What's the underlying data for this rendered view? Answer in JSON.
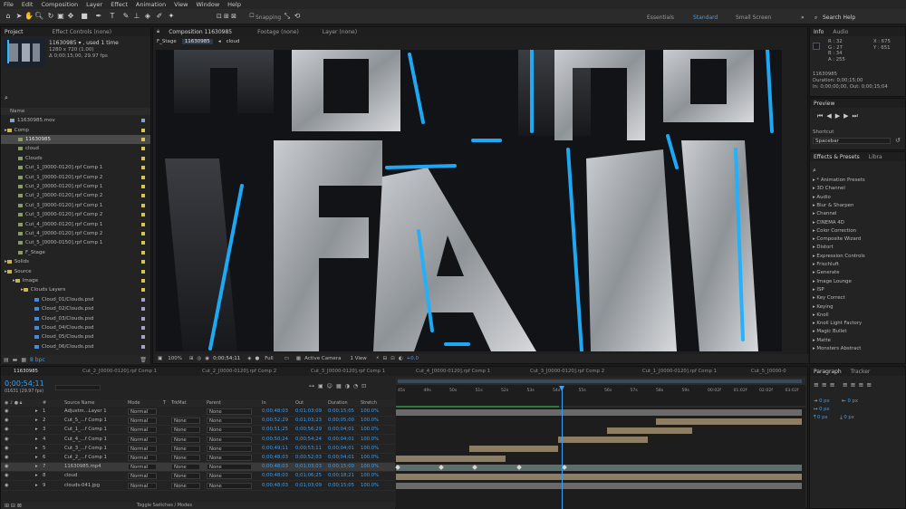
{
  "menu": [
    "File",
    "Edit",
    "Composition",
    "Layer",
    "Effect",
    "Animation",
    "View",
    "Window",
    "Help"
  ],
  "toolbar": {
    "snapping": "Snapping",
    "workspaces": [
      "Essentials",
      "Standard",
      "Small Screen"
    ],
    "search_placeholder": "Search Help"
  },
  "project": {
    "tabs": [
      "Project",
      "Effect Controls (none)"
    ],
    "item_name": "11630985 ▾ , used 1 time",
    "item_res": "1280 x 720 (1.00)",
    "item_dur": "Δ 0;00;15;00, 29.97 fps",
    "name_header": "Name",
    "bpc": "8 bpc",
    "tree": [
      {
        "label": "11630985.mov",
        "indent": 0,
        "kind": "file",
        "color": "#7fa6c8"
      },
      {
        "label": "Comp",
        "indent": 0,
        "kind": "folder",
        "color": "#d9c54a"
      },
      {
        "label": "11630985",
        "indent": 1,
        "kind": "comp",
        "color": "#d9c54a",
        "selected": true
      },
      {
        "label": "cloud",
        "indent": 1,
        "kind": "comp",
        "color": "#d9c54a"
      },
      {
        "label": "Clouds",
        "indent": 1,
        "kind": "comp",
        "color": "#d9c54a"
      },
      {
        "label": "Cut_1_[0000-0120].rpf Comp 1",
        "indent": 1,
        "kind": "comp",
        "color": "#d9c54a"
      },
      {
        "label": "Cut_1_[0000-0120].rpf Comp 2",
        "indent": 1,
        "kind": "comp",
        "color": "#d9c54a"
      },
      {
        "label": "Cut_2_[0000-0120].rpf Comp 1",
        "indent": 1,
        "kind": "comp",
        "color": "#d9c54a"
      },
      {
        "label": "Cut_2_[0000-0120].rpf Comp 2",
        "indent": 1,
        "kind": "comp",
        "color": "#d9c54a"
      },
      {
        "label": "Cut_3_[0000-0120].rpf Comp 1",
        "indent": 1,
        "kind": "comp",
        "color": "#d9c54a"
      },
      {
        "label": "Cut_3_[0000-0120].rpf Comp 2",
        "indent": 1,
        "kind": "comp",
        "color": "#d9c54a"
      },
      {
        "label": "Cut_4_[0000-0120].rpf Comp 1",
        "indent": 1,
        "kind": "comp",
        "color": "#d9c54a"
      },
      {
        "label": "Cut_4_[0000-0120].rpf Comp 2",
        "indent": 1,
        "kind": "comp",
        "color": "#d9c54a"
      },
      {
        "label": "Cut_5_[0000-0150].rpf Comp 1",
        "indent": 1,
        "kind": "comp",
        "color": "#d9c54a"
      },
      {
        "label": "F_Stage",
        "indent": 1,
        "kind": "comp",
        "color": "#d9c54a"
      },
      {
        "label": "Solids",
        "indent": 0,
        "kind": "folder",
        "color": "#d9c54a"
      },
      {
        "label": "Source",
        "indent": 0,
        "kind": "folder",
        "color": "#d9c54a"
      },
      {
        "label": "Image",
        "indent": 1,
        "kind": "folder",
        "color": "#d9c54a"
      },
      {
        "label": "Clouds Layers",
        "indent": 2,
        "kind": "folder",
        "color": "#d9c54a"
      },
      {
        "label": "Cloud_01/Clouds.psd",
        "indent": 3,
        "kind": "psd",
        "color": "#a3a3c8"
      },
      {
        "label": "Cloud_02/Clouds.psd",
        "indent": 3,
        "kind": "psd",
        "color": "#a3a3c8"
      },
      {
        "label": "Cloud_03/Clouds.psd",
        "indent": 3,
        "kind": "psd",
        "color": "#a3a3c8"
      },
      {
        "label": "Cloud_04/Clouds.psd",
        "indent": 3,
        "kind": "psd",
        "color": "#a3a3c8"
      },
      {
        "label": "Cloud_05/Clouds.psd",
        "indent": 3,
        "kind": "psd",
        "color": "#a3a3c8"
      },
      {
        "label": "Cloud_06/Clouds.psd",
        "indent": 3,
        "kind": "psd",
        "color": "#a3a3c8"
      }
    ]
  },
  "comp": {
    "tabs": [
      "Composition 11630985",
      "Footage (none)",
      "Layer (none)"
    ],
    "crumbs": [
      "F_Stage",
      "11630985",
      "cloud"
    ],
    "footer": {
      "zoom": "100%",
      "time": "0;00;54;11",
      "res": "Full",
      "camera": "Active Camera",
      "view": "1 View",
      "exposure": "+0.0"
    }
  },
  "info": {
    "tabs": [
      "Info",
      "Audio"
    ],
    "r": "R : 32",
    "g": "G : 27",
    "b": "B : 34",
    "a": "A : 255",
    "x": "X : 675",
    "y": "Y : 651",
    "name": "11630985",
    "duration": "Duration: 0;00;15;00",
    "inout": "In: 0;00;00;00, Out: 0;00;15;04"
  },
  "preview": {
    "title": "Preview",
    "shortcut_label": "Shortcut",
    "shortcut_value": "Spacebar"
  },
  "effects": {
    "tabs": [
      "Effects & Presets",
      "Libra"
    ],
    "items": [
      "* Animation Presets",
      "3D Channel",
      "Audio",
      "Blur & Sharpen",
      "Channel",
      "CINEMA 4D",
      "Color Correction",
      "Composite Wizard",
      "Distort",
      "Expression Controls",
      "Frischluft",
      "Generate",
      "Image Lounge",
      "ISP",
      "Key Correct",
      "Keying",
      "Knoll",
      "Knoll Light Factory",
      "Magic Bullet",
      "Matte",
      "Monsters Abstract"
    ]
  },
  "timeline": {
    "tabs": [
      "11630985",
      "Cut_2_[0000-0120].rpf Comp 1",
      "Cut_2_[0000-0120].rpf Comp 2",
      "Cut_3_[0000-0120].rpf Comp 1",
      "Cut_4_[0000-0120].rpf Comp 1",
      "Cut_3_[0000-0120].rpf Comp 2",
      "Cut_1_[0000-0120].rpf Comp 1",
      "Cut_5_[0000-0"
    ],
    "time": "0;00;54;11",
    "fps": "01631 (29.97 fps)",
    "headers": [
      "Source Name",
      "Mode",
      "T",
      "TrkMat",
      "Parent",
      "In",
      "Out",
      "Duration",
      "Stretch"
    ],
    "ruler": [
      "45s",
      "49s",
      "50s",
      "51s",
      "52s",
      "53s",
      "54s",
      "55s",
      "56s",
      "57s",
      "58s",
      "59s",
      "00:02f",
      "01:02f",
      "02:02f",
      "03:02f"
    ],
    "toggle_label": "Toggle Switches / Modes",
    "layers": [
      {
        "n": "1",
        "name": "Adjustm...Layer 1",
        "mode": "Normal",
        "trk": "",
        "parent": "None",
        "in": "0;00;48;03",
        "out": "0;01;03;09",
        "dur": "0;00;15;05",
        "str": "100.0%",
        "bar_start": 0.0,
        "bar_end": 1.0,
        "bar": "grey"
      },
      {
        "n": "2",
        "name": "Cut_5_...f Comp 1",
        "mode": "Normal",
        "trk": "None",
        "parent": "None",
        "in": "0;00;52;29",
        "out": "0;01;03;23",
        "dur": "0;00;05;00",
        "str": "100.0%",
        "bar_start": 0.64,
        "bar_end": 1.0,
        "bar": "tan"
      },
      {
        "n": "3",
        "name": "Cut_1_...f Comp 1",
        "mode": "Normal",
        "trk": "None",
        "parent": "None",
        "in": "0;00;51;25",
        "out": "0;00;56;29",
        "dur": "0;00;04;01",
        "str": "100.0%",
        "bar_start": 0.52,
        "bar_end": 0.73,
        "bar": "tan"
      },
      {
        "n": "4",
        "name": "Cut_4_...f Comp 1",
        "mode": "Normal",
        "trk": "None",
        "parent": "None",
        "in": "0;00;50;24",
        "out": "0;00;54;24",
        "dur": "0;00;04;01",
        "str": "100.0%",
        "bar_start": 0.4,
        "bar_end": 0.62,
        "bar": "tan"
      },
      {
        "n": "5",
        "name": "Cut_3_...f Comp 1",
        "mode": "Normal",
        "trk": "None",
        "parent": "None",
        "in": "0;00;49;11",
        "out": "0;00;53;11",
        "dur": "0;00;04;01",
        "str": "100.0%",
        "bar_start": 0.18,
        "bar_end": 0.4,
        "bar": "tan"
      },
      {
        "n": "6",
        "name": "Cut_2_...f Comp 1",
        "mode": "Normal",
        "trk": "None",
        "parent": "None",
        "in": "0;00;48;03",
        "out": "0;00;52;03",
        "dur": "0;00;04;01",
        "str": "100.0%",
        "bar_start": 0.0,
        "bar_end": 0.27,
        "bar": "tan"
      },
      {
        "n": "7",
        "name": "11630985.mp4",
        "mode": "Normal",
        "trk": "None",
        "parent": "None",
        "in": "0;00;48;03",
        "out": "0;01;03;03",
        "dur": "0;00;15;00",
        "str": "100.0%",
        "bar_start": 0.0,
        "bar_end": 1.0,
        "bar": "teal",
        "selected": true
      },
      {
        "n": "8",
        "name": "cloud",
        "mode": "Normal",
        "trk": "None",
        "parent": "None",
        "in": "0;00;48;03",
        "out": "0;01;06;25",
        "dur": "0;00;18;21",
        "str": "100.0%",
        "bar_start": 0.0,
        "bar_end": 1.0,
        "bar": "tan"
      },
      {
        "n": "9",
        "name": "clouds-041.jpg",
        "mode": "Normal",
        "trk": "None",
        "parent": "None",
        "in": "0;00;48;03",
        "out": "0;01;03;09",
        "dur": "0;00;15;05",
        "str": "100.0%",
        "bar_start": 0.0,
        "bar_end": 1.0,
        "bar": "grey"
      }
    ]
  },
  "paragraph": {
    "tabs": [
      "Paragraph",
      "Tracker"
    ],
    "fields": [
      "0 px",
      "0 px",
      "0 px",
      "0 px",
      "0 px"
    ]
  }
}
